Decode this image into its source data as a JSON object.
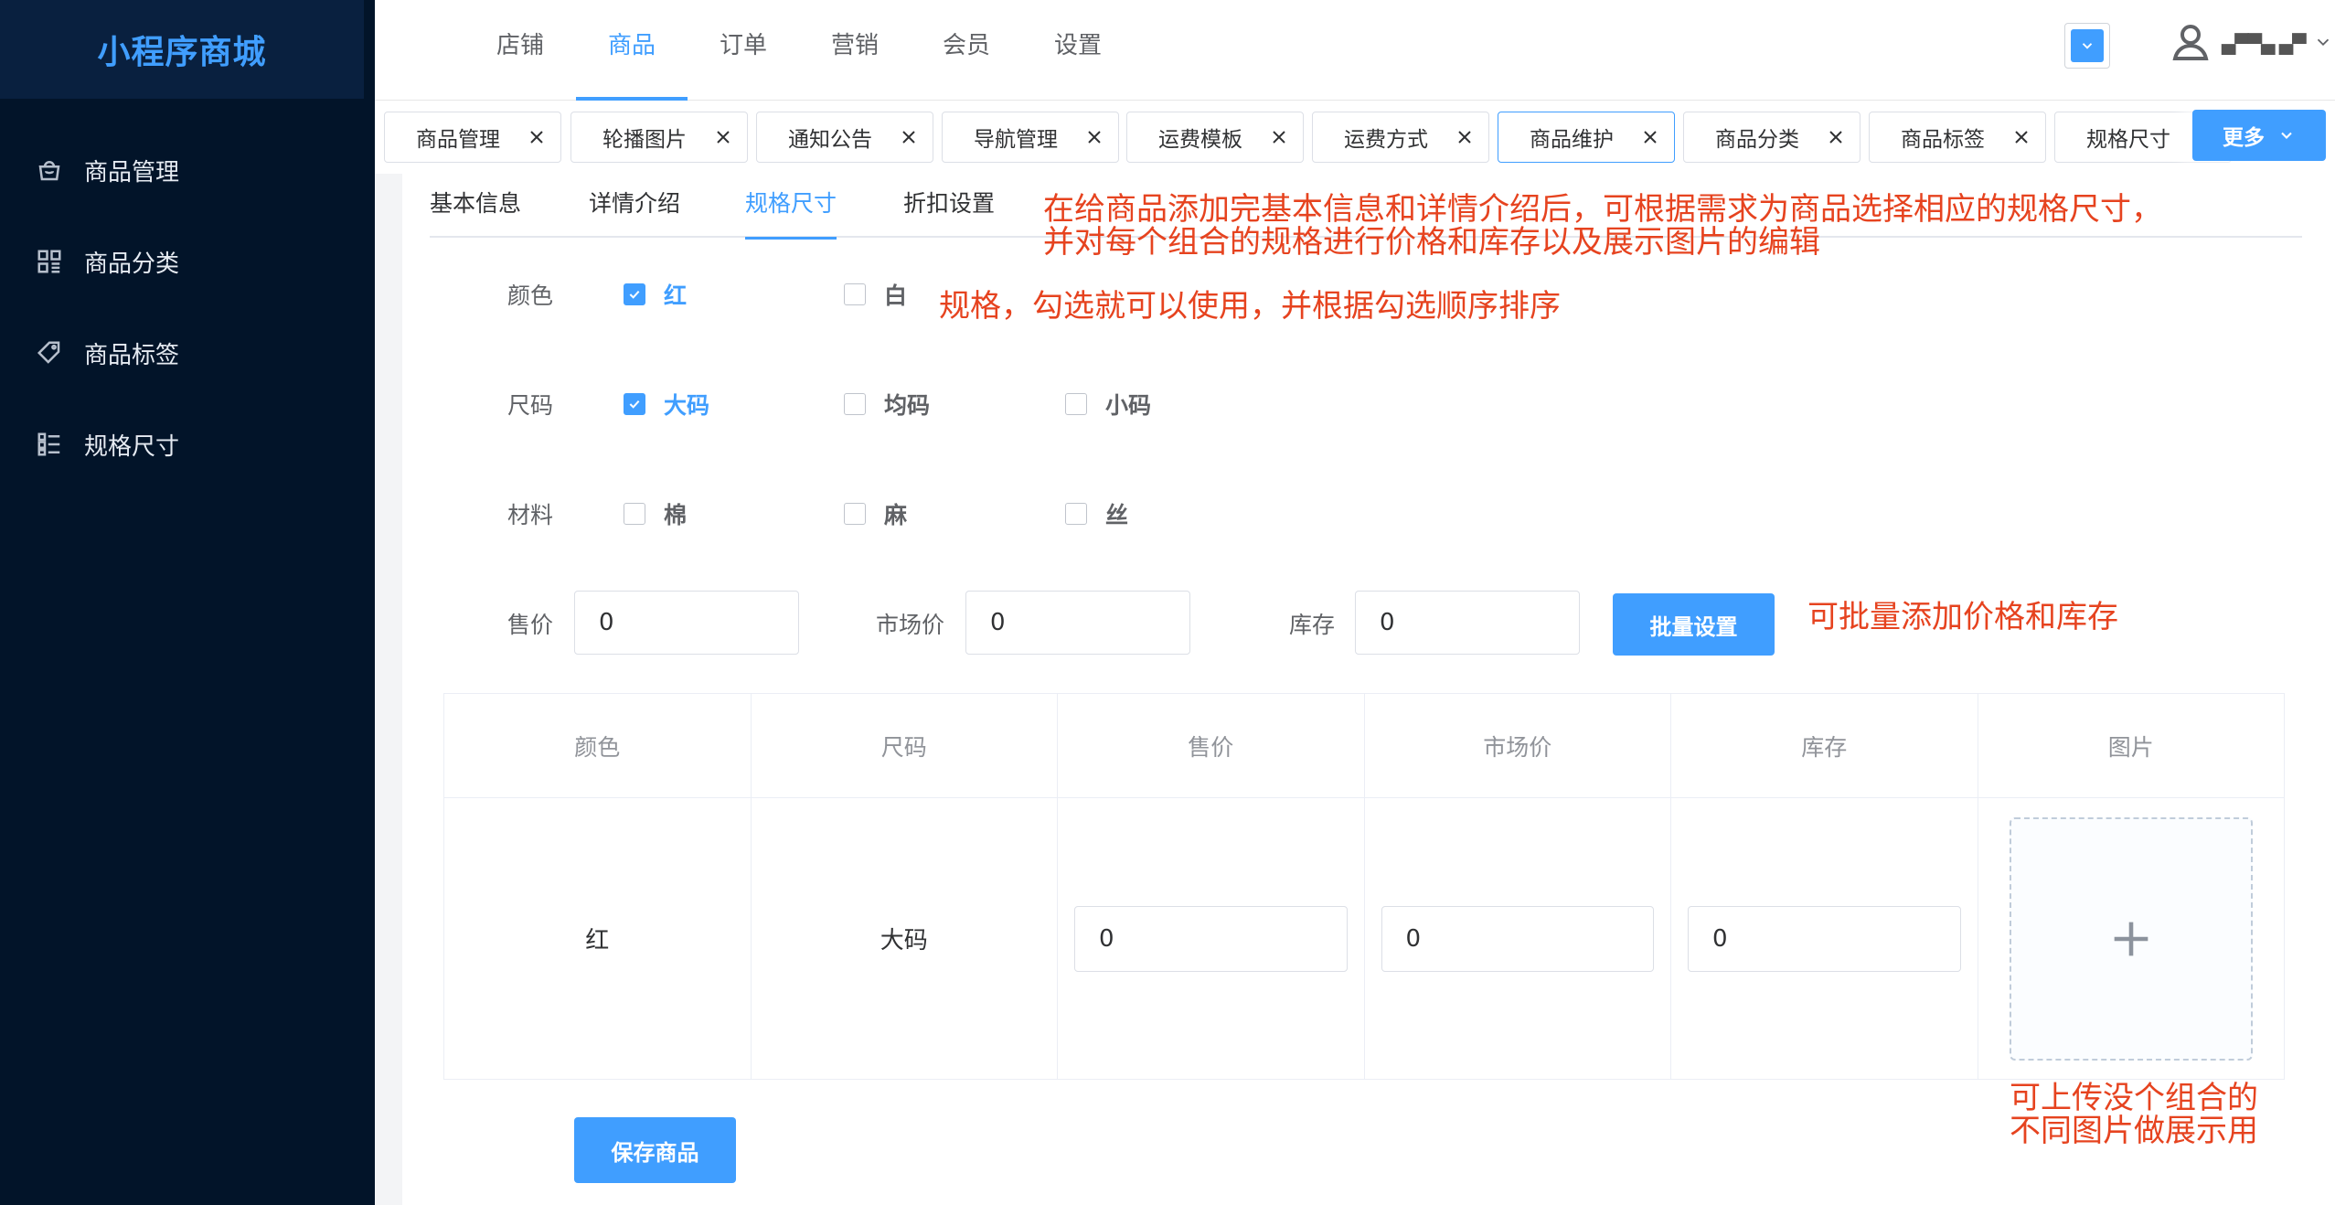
{
  "brand": "小程序商城",
  "sidebar": {
    "items": [
      {
        "label": "商品管理",
        "icon": "shopping-bag-icon"
      },
      {
        "label": "商品分类",
        "icon": "grid-icon"
      },
      {
        "label": "商品标签",
        "icon": "tag-icon"
      },
      {
        "label": "规格尺寸",
        "icon": "list-icon"
      }
    ]
  },
  "top_nav": {
    "items": [
      "店铺",
      "商品",
      "订单",
      "营销",
      "会员",
      "设置"
    ],
    "active": "商品"
  },
  "header": {
    "username": "▄▀▀▄ ▄▀"
  },
  "tabs": {
    "items": [
      "商品管理",
      "轮播图片",
      "通知公告",
      "导航管理",
      "运费模板",
      "运费方式",
      "商品维护",
      "商品分类",
      "商品标签",
      "规格尺寸"
    ],
    "active": "商品维护",
    "more_label": "更多"
  },
  "form_tabs": {
    "items": [
      "基本信息",
      "详情介绍",
      "规格尺寸",
      "折扣设置"
    ],
    "active": "规格尺寸"
  },
  "specs": [
    {
      "label": "颜色",
      "options": [
        {
          "name": "红",
          "checked": true
        },
        {
          "name": "白",
          "checked": false
        }
      ]
    },
    {
      "label": "尺码",
      "options": [
        {
          "name": "大码",
          "checked": true
        },
        {
          "name": "均码",
          "checked": false
        },
        {
          "name": "小码",
          "checked": false
        }
      ]
    },
    {
      "label": "材料",
      "options": [
        {
          "name": "棉",
          "checked": false
        },
        {
          "name": "麻",
          "checked": false
        },
        {
          "name": "丝",
          "checked": false
        }
      ]
    }
  ],
  "batch": {
    "price_label": "售价",
    "price_value": "0",
    "market_label": "市场价",
    "market_value": "0",
    "stock_label": "库存",
    "stock_value": "0",
    "button_label": "批量设置"
  },
  "table": {
    "headers": [
      "颜色",
      "尺码",
      "售价",
      "市场价",
      "库存",
      "图片"
    ],
    "rows": [
      {
        "color": "红",
        "size": "大码",
        "price": "0",
        "market": "0",
        "stock": "0"
      }
    ]
  },
  "save_label": "保存商品",
  "annotations": {
    "intro_line1": "在给商品添加完基本信息和详情介绍后，可根据需求为商品选择相应的规格尺寸，",
    "intro_line2": "并对每个组合的规格进行价格和库存以及展示图片的编辑",
    "spec_note": "规格，勾选就可以使用，并根据勾选顺序排序",
    "batch_note": "可批量添加价格和库存",
    "upload_line1": "可上传没个组合的",
    "upload_line2": "不同图片做展示用"
  },
  "colors": {
    "accent": "#409eff",
    "sidebar_bg": "#021429",
    "annotation": "#e6431f"
  }
}
